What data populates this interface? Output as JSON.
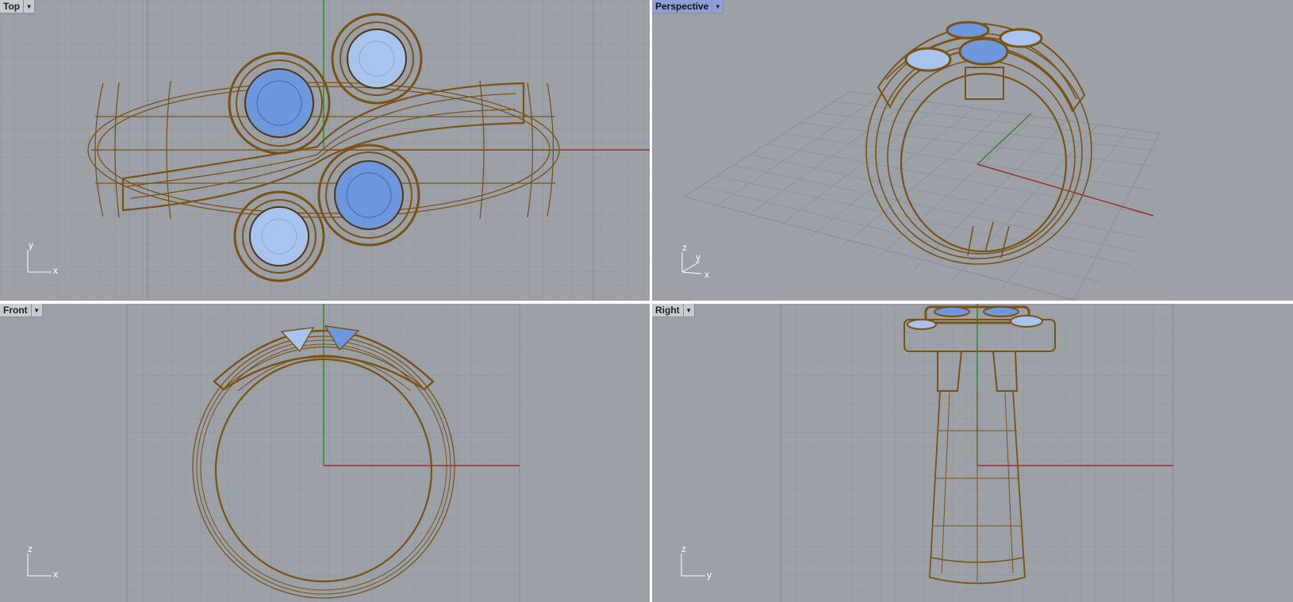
{
  "viewports": {
    "top": {
      "label": "Top",
      "axis_h": "x",
      "axis_v": "y"
    },
    "perspective": {
      "label": "Perspective",
      "axis_h": "x",
      "axis_v": "y",
      "axis_z": "z"
    },
    "front": {
      "label": "Front",
      "axis_h": "x",
      "axis_v": "z"
    },
    "right": {
      "label": "Right",
      "axis_h": "y",
      "axis_v": "z"
    }
  },
  "icons": {
    "viewport_menu": "triangle-down-icon"
  },
  "colors": {
    "viewport_bg": "#9ca1a8",
    "grid_minor": "#8f949b",
    "grid_major": "#7f848b",
    "x_axis": "#9a2f2f",
    "y_axis": "#2f8a2f",
    "wireframe": "#7a5214",
    "gem": "#6f97dd",
    "gem_light": "#a8c3ee",
    "active_label": "#8fa0d8"
  }
}
